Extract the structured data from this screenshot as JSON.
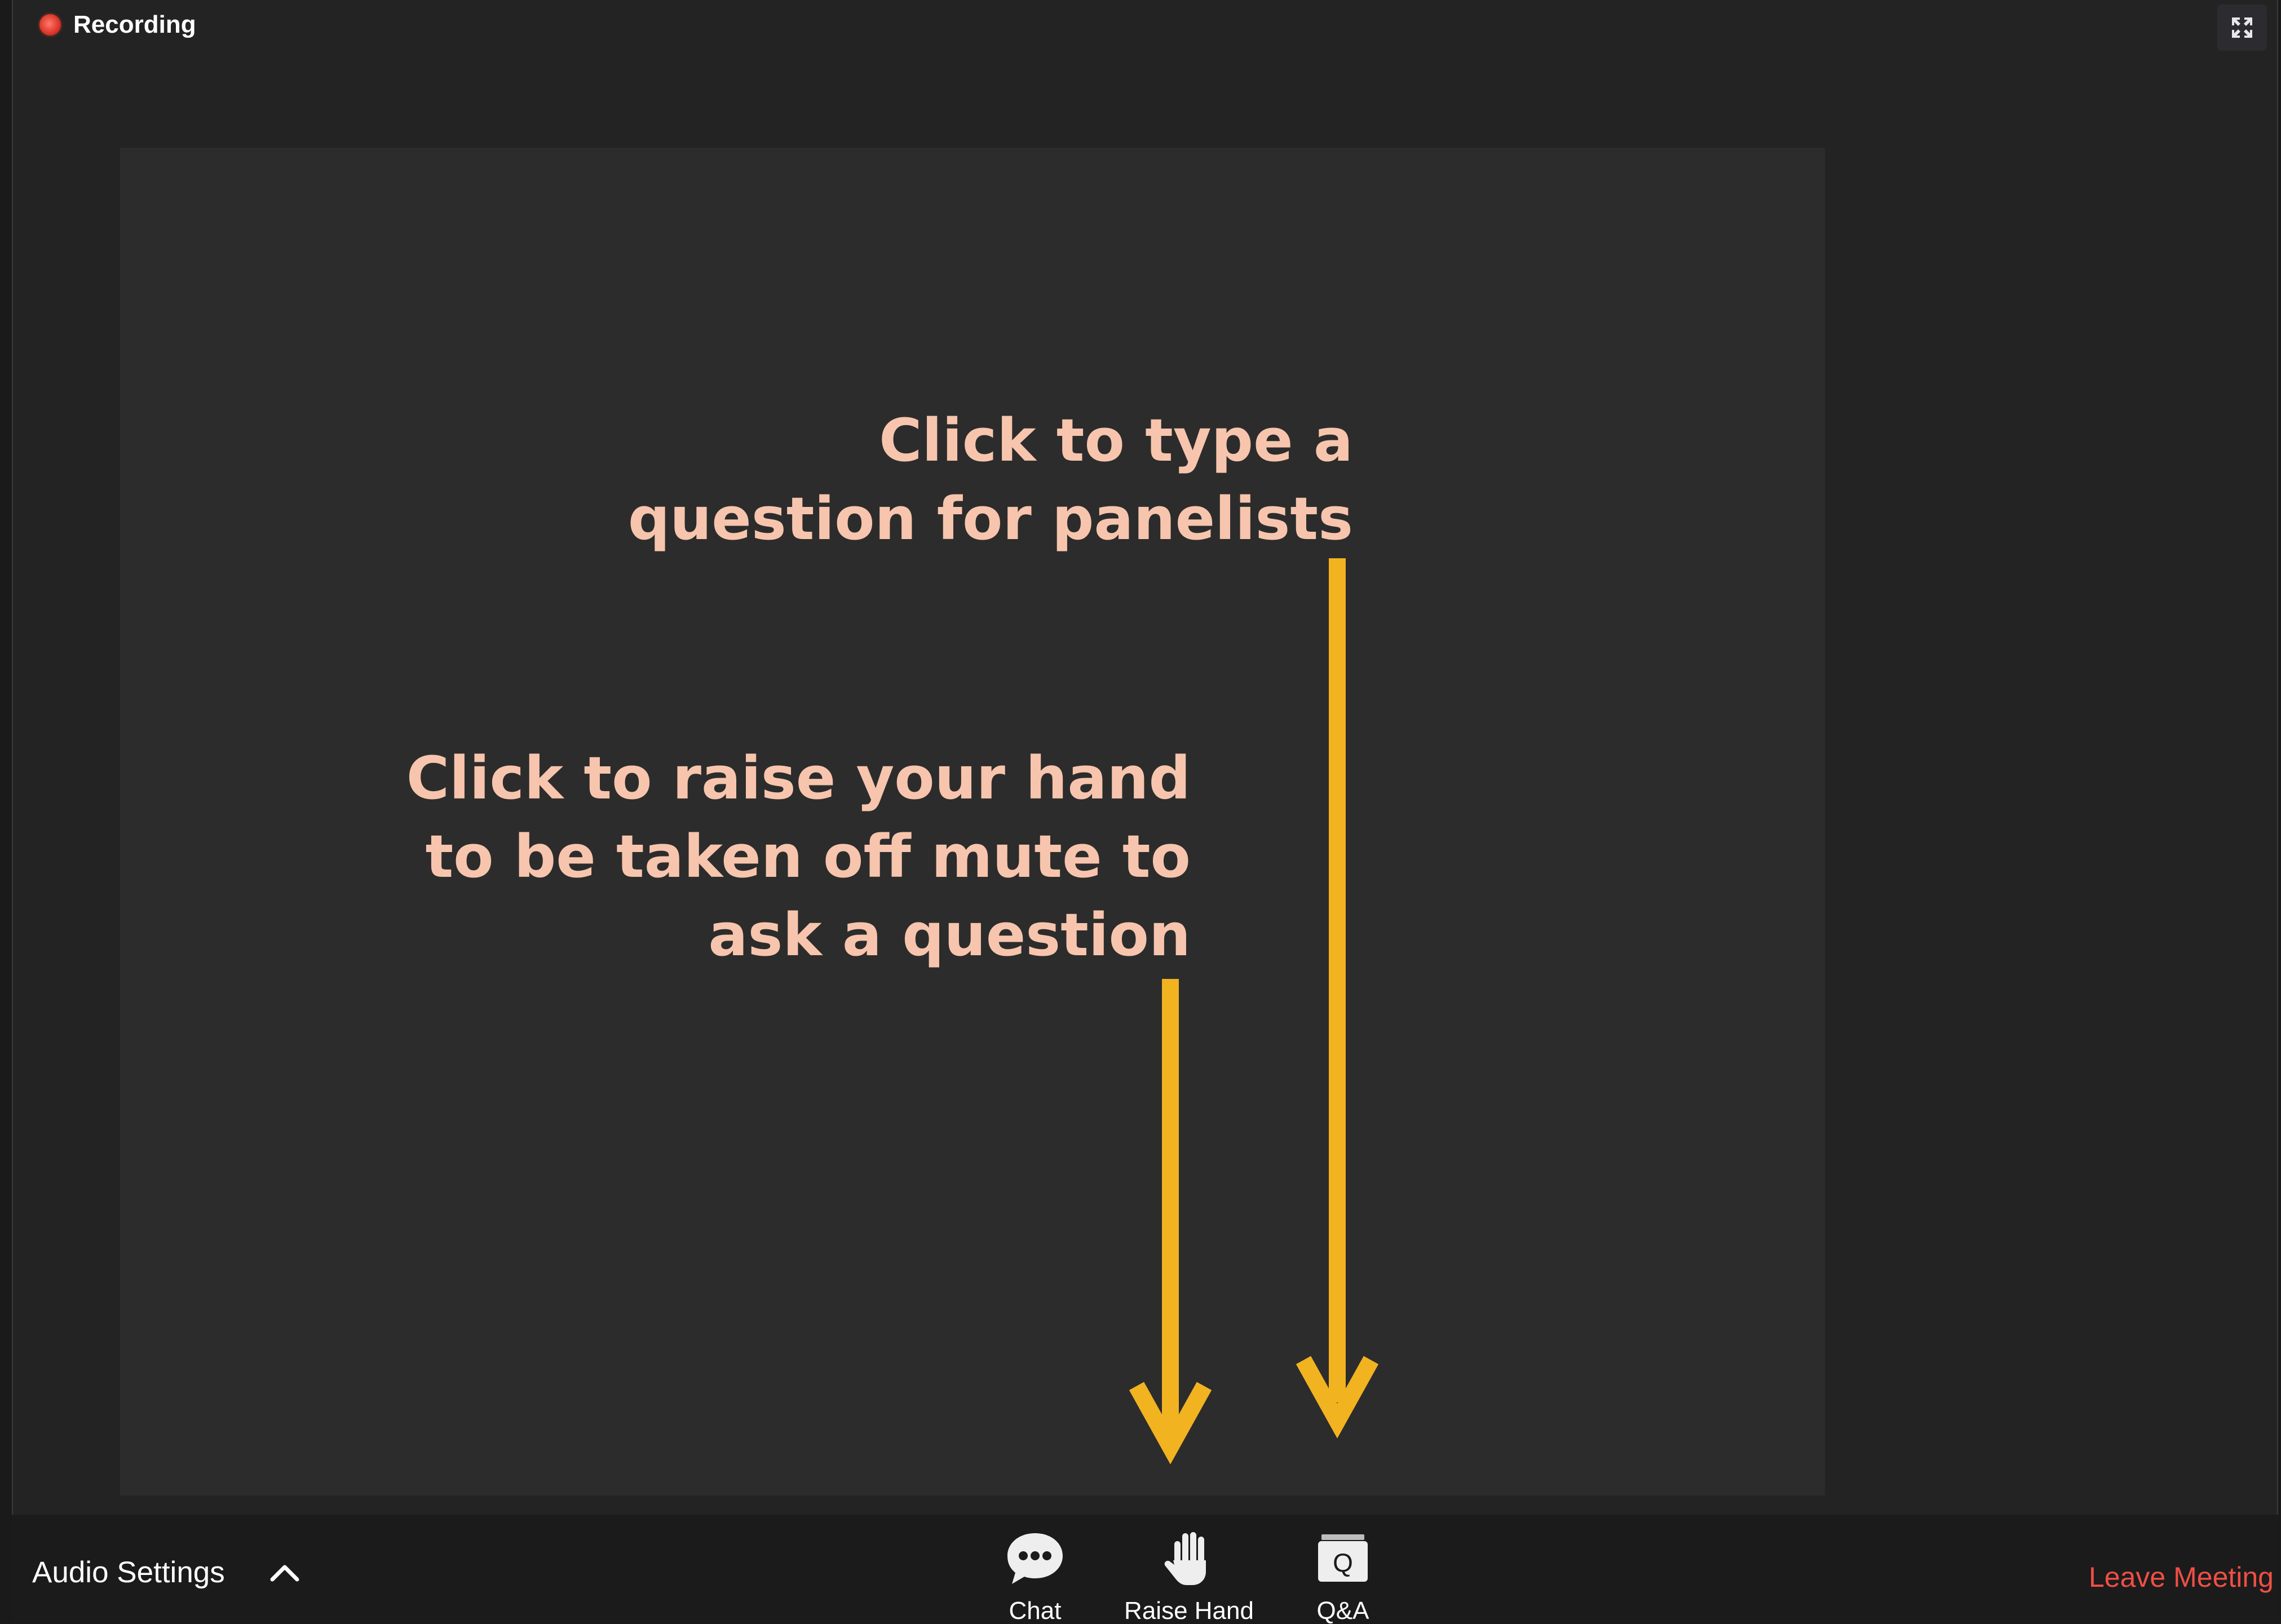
{
  "window": {
    "recording_label": "Recording",
    "fullscreen_icon": "exit-fullscreen-icon"
  },
  "annotations": {
    "qa_hint": [
      "Click to type a",
      "question for panelists"
    ],
    "raise_hand_hint": [
      "Click to raise your hand",
      "to be taken off mute to",
      "ask a question"
    ],
    "text_color": "#f7c5ad",
    "arrow_color": "#f2b321"
  },
  "toolbar": {
    "audio_settings_label": "Audio Settings",
    "audio_menu_icon": "chevron-up-icon",
    "buttons": [
      {
        "label": "Chat",
        "icon": "chat-bubble-icon"
      },
      {
        "label": "Raise Hand",
        "icon": "raise-hand-icon"
      },
      {
        "label": "Q&A",
        "icon": "qa-icon"
      }
    ],
    "leave_label": "Leave Meeting",
    "leave_color": "#ee4f45"
  }
}
